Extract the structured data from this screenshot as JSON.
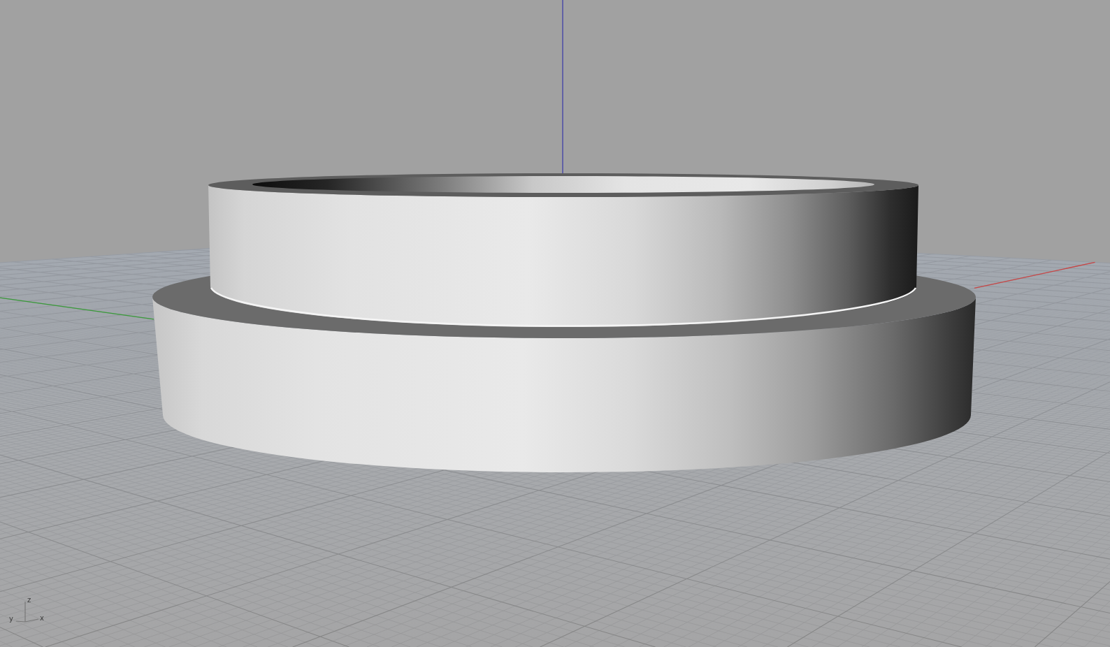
{
  "viewport": {
    "axis_gizmo": [
      {
        "kind": "z",
        "label": "z"
      },
      {
        "kind": "y",
        "label": "y"
      },
      {
        "kind": "x",
        "label": "x"
      }
    ]
  }
}
